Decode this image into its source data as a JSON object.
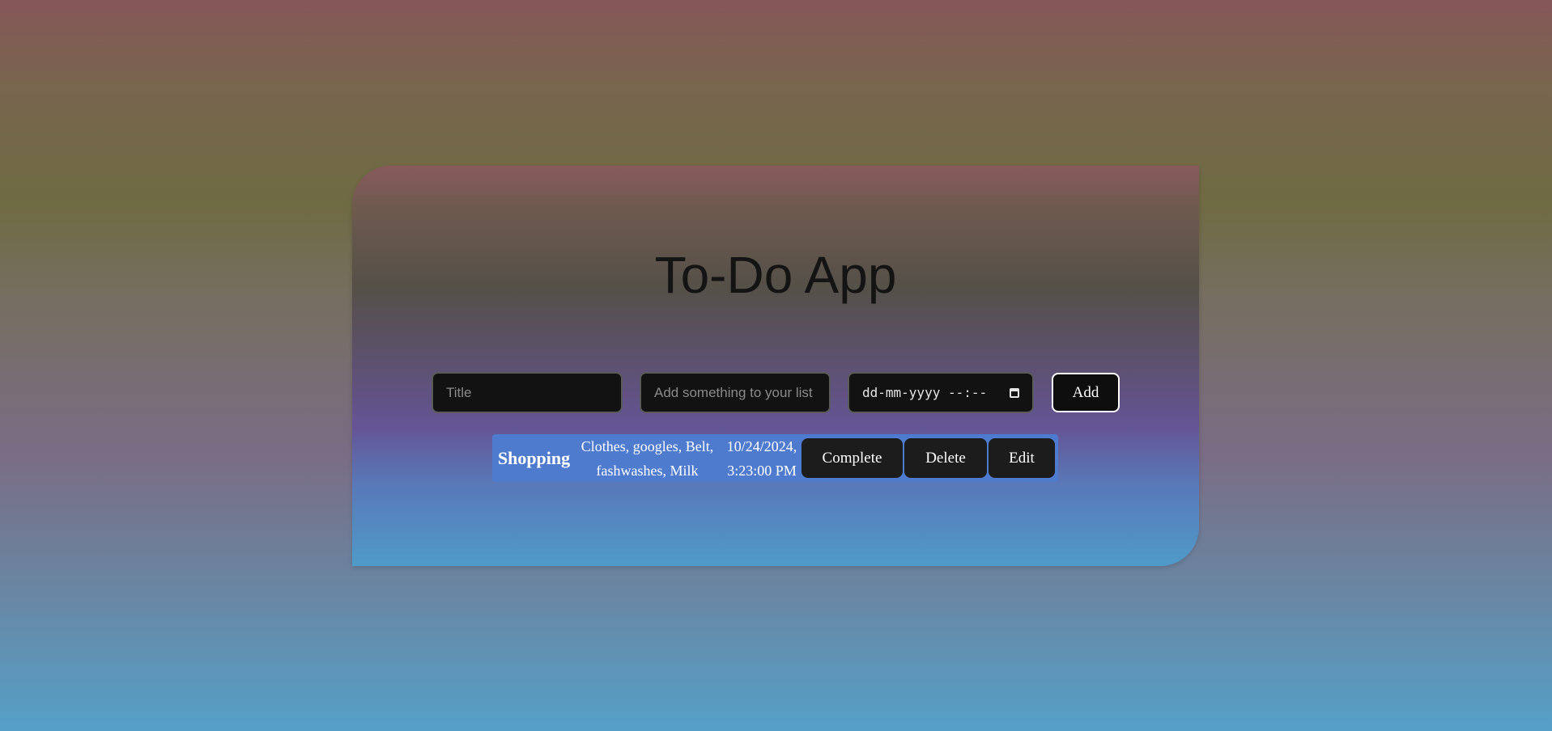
{
  "app": {
    "title": "To-Do App"
  },
  "form": {
    "title_placeholder": "Title",
    "description_placeholder": "Add something to your list",
    "datetime_placeholder": "dd-mm-yyyy --:--",
    "add_label": "Add"
  },
  "todos": [
    {
      "title": "Shopping",
      "description": "Clothes, googles, Belt, fashwashes, Milk",
      "date": "10/24/2024, 3:23:00 PM",
      "complete_label": "Complete",
      "delete_label": "Delete",
      "edit_label": "Edit"
    }
  ],
  "icons": {
    "datetime": "calendar-icon"
  }
}
